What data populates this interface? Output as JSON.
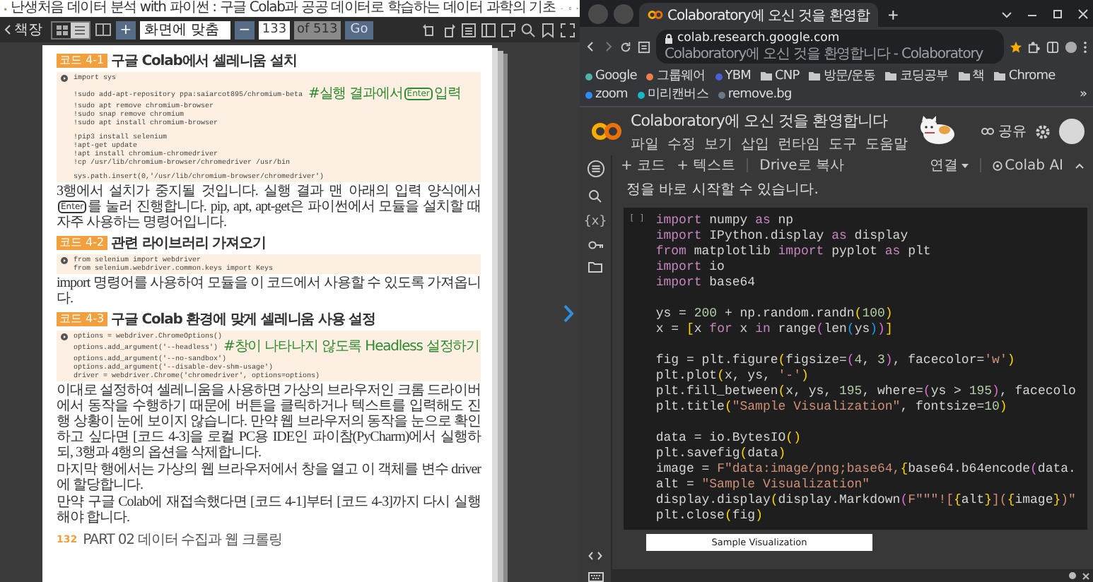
{
  "reader": {
    "title": "난생처음 데이터 분석 with 파이썬 : 구글 Colab과 공공 데이터로 학습하는 데이터 과학의 기초",
    "back_label": "책장",
    "view_modes": [
      {
        "kind": "grid",
        "selected": false
      },
      {
        "kind": "list",
        "selected": true
      }
    ],
    "zoom_in": "+",
    "zoom_mode": "화면에 맞춤",
    "zoom_out": "−",
    "page_input": "133",
    "page_total": "of 513",
    "go": "Go",
    "page": {
      "blocks": [
        {
          "kind": "code",
          "label": "코드 4-1",
          "title": "구글 Colab에서 셀레니움 설치",
          "lines": [
            {
              "kind": "code",
              "text": "import sys"
            },
            {
              "kind": "blank"
            },
            {
              "kind": "code",
              "text": "!sudo add-apt-repository ppa:saiarcot895/chromium-beta",
              "comment": [
                {
                  "kind": "text",
                  "text": "#실행 결과에서"
                },
                {
                  "kind": "key",
                  "text": "Enter"
                },
                {
                  "kind": "text",
                  "text": "입력"
                }
              ]
            },
            {
              "kind": "code",
              "text": "!sudo apt remove chromium-browser"
            },
            {
              "kind": "code",
              "text": "!sudo snap remove chromium"
            },
            {
              "kind": "code",
              "text": "!sudo apt install chromium-browser"
            },
            {
              "kind": "blank"
            },
            {
              "kind": "code",
              "text": "!pip3 install selenium"
            },
            {
              "kind": "code",
              "text": "!apt-get update"
            },
            {
              "kind": "code",
              "text": "!apt install chromium-chromedriver"
            },
            {
              "kind": "code",
              "text": "!cp /usr/lib/chromium-browser/chromedriver /usr/bin"
            },
            {
              "kind": "blank"
            },
            {
              "kind": "code",
              "text": "sys.path.insert(0,'/usr/lib/chromium-browser/chromedriver')"
            }
          ]
        },
        {
          "kind": "para",
          "segments": [
            {
              "kind": "text",
              "text": "3행에서 설치가 중지될 것입니다. 실행 결과 맨 아래의 입력 양식에서 "
            },
            {
              "kind": "key",
              "text": "Enter"
            },
            {
              "kind": "text",
              "text": "를 눌러 진행합니다. pip, apt, apt-get은 파이썬에서 모듈을 설치할 때 자주 사용하는 명령어입니다."
            }
          ]
        },
        {
          "kind": "code",
          "label": "코드 4-2",
          "title": "관련 라이브러리 가져오기",
          "lines": [
            {
              "kind": "code",
              "text": "from selenium import webdriver"
            },
            {
              "kind": "code",
              "text": "from selenium.webdriver.common.keys import Keys"
            }
          ]
        },
        {
          "kind": "para",
          "segments": [
            {
              "kind": "text",
              "text": "import 명령어를 사용하여 모듈을 이 코드에서 사용할 수 있도록 가져옵니다."
            }
          ]
        },
        {
          "kind": "code",
          "label": "코드 4-3",
          "title": "구글 Colab 환경에 맞게 셀레니움 사용 설정",
          "lines": [
            {
              "kind": "code",
              "text": "options = webdriver.ChromeOptions()"
            },
            {
              "kind": "code",
              "text": "options.add_argument('--headless')",
              "comment": [
                {
                  "kind": "text",
                  "text": "#창이 나타나지 않도록 Headless 설정하기"
                }
              ]
            },
            {
              "kind": "code",
              "text": "options.add_argument('--no-sandbox')"
            },
            {
              "kind": "code",
              "text": "options.add_argument('--disable-dev-shm-usage')"
            },
            {
              "kind": "code",
              "text": "driver = webdriver.Chrome('chromedriver', options=options)"
            }
          ]
        },
        {
          "kind": "para",
          "segments": [
            {
              "kind": "text",
              "text": "이대로 설정하여 셀레니움을 사용하면 가상의 브라우저인 크롬 드라이버에서 동작을 수행하기 때문에 버튼을 클릭하거나 텍스트를 입력해도 진행 상황이 눈에 보이지 않습니다. 만약 웹 브라우저의 동작을 눈으로 확인하고 싶다면 [코드 4-3]을 로컬 PC용 IDE인 파이참(PyCharm)에서 실행하되, 3행과 4행의 옵션을 삭제합니다."
            }
          ]
        },
        {
          "kind": "para",
          "segments": [
            {
              "kind": "text",
              "text": "마지막 행에서는 가상의 웹 브라우저에서 창을 열고 이 객체를 변수 driver에 할당합니다."
            }
          ]
        },
        {
          "kind": "para",
          "segments": [
            {
              "kind": "text",
              "text": "만약 구글 Colab에 재접속했다면 [코드 4-1]부터 [코드 4-3]까지 다시 실행해야 합니다."
            }
          ]
        }
      ],
      "footer": {
        "number": "132",
        "part": "PART 02 데이터 수집과 웹 크롤링"
      }
    }
  },
  "browser": {
    "tabs": [
      {
        "title": "Colaboratory에 오신 것을 환영합",
        "selected": true
      }
    ],
    "new_tab": "+",
    "url_host": "colab.research.google.com",
    "url_title": "Colaboratory에 오신 것을 환영합니다 - Colaboratory",
    "bookmarks": [
      {
        "kind": "site",
        "label": "Google",
        "color": "#4fb3a9"
      },
      {
        "kind": "site",
        "label": "그룹웨어",
        "color": "#f07c4a"
      },
      {
        "kind": "site",
        "label": "YBM",
        "color": "#4a5fd6"
      },
      {
        "kind": "folder",
        "label": "CNP"
      },
      {
        "kind": "folder",
        "label": "방문/운동"
      },
      {
        "kind": "folder",
        "label": "코딩공부"
      },
      {
        "kind": "folder",
        "label": "책"
      },
      {
        "kind": "folder",
        "label": "Chrome"
      },
      {
        "kind": "site",
        "label": "zoom",
        "color": "#2d8cff"
      },
      {
        "kind": "site",
        "label": "미리캔버스",
        "color": "#18b7c9"
      },
      {
        "kind": "site",
        "label": "remove.bg",
        "color": "#6b7785"
      }
    ],
    "more": "»"
  },
  "colab": {
    "title": "Colaboratory에 오신 것을 환영합니다",
    "menu": [
      "파일",
      "수정",
      "보기",
      "삽입",
      "런타임",
      "도구",
      "도움말"
    ],
    "share": "공유",
    "sidebar_variables": "{x}",
    "toolbar": {
      "add_code": "+ 코드",
      "add_text": "+ 텍스트",
      "copy_drive": "Drive로 복사",
      "connect": "연결",
      "ai": "Colab AI"
    },
    "text_cell": "정을 바로 시작할 수 있습니다.",
    "cell": {
      "bracket": "[ ]",
      "lines": [
        {
          "kind": "code",
          "tokens": [
            {
              "kind": "keyword",
              "text": "import"
            },
            {
              "kind": "plain",
              "text": " numpy "
            },
            {
              "kind": "keyword",
              "text": "as"
            },
            {
              "kind": "plain",
              "text": " np"
            }
          ]
        },
        {
          "kind": "code",
          "tokens": [
            {
              "kind": "keyword",
              "text": "import"
            },
            {
              "kind": "plain",
              "text": " IPython.display "
            },
            {
              "kind": "keyword",
              "text": "as"
            },
            {
              "kind": "plain",
              "text": " display"
            }
          ]
        },
        {
          "kind": "code",
          "tokens": [
            {
              "kind": "keyword",
              "text": "from"
            },
            {
              "kind": "plain",
              "text": " matplotlib "
            },
            {
              "kind": "keyword",
              "text": "import"
            },
            {
              "kind": "plain",
              "text": " pyplot "
            },
            {
              "kind": "keyword",
              "text": "as"
            },
            {
              "kind": "plain",
              "text": " plt"
            }
          ]
        },
        {
          "kind": "code",
          "tokens": [
            {
              "kind": "keyword",
              "text": "import"
            },
            {
              "kind": "plain",
              "text": " io"
            }
          ]
        },
        {
          "kind": "code",
          "tokens": [
            {
              "kind": "keyword",
              "text": "import"
            },
            {
              "kind": "plain",
              "text": " base64"
            }
          ]
        },
        {
          "kind": "blank"
        },
        {
          "kind": "code",
          "tokens": [
            {
              "kind": "plain",
              "text": "ys = "
            },
            {
              "kind": "number",
              "text": "200"
            },
            {
              "kind": "plain",
              "text": " + np.random.randn"
            },
            {
              "kind": "bracket",
              "text": "("
            },
            {
              "kind": "number",
              "text": "100"
            },
            {
              "kind": "bracket",
              "text": ")"
            }
          ]
        },
        {
          "kind": "code",
          "tokens": [
            {
              "kind": "plain",
              "text": "x = "
            },
            {
              "kind": "bracket",
              "text": "["
            },
            {
              "kind": "plain",
              "text": "x "
            },
            {
              "kind": "keyword",
              "text": "for"
            },
            {
              "kind": "plain",
              "text": " x "
            },
            {
              "kind": "keyword",
              "text": "in"
            },
            {
              "kind": "plain",
              "text": " range"
            },
            {
              "kind": "bracket2",
              "text": "("
            },
            {
              "kind": "plain",
              "text": "len"
            },
            {
              "kind": "bracket3",
              "text": "("
            },
            {
              "kind": "plain",
              "text": "ys"
            },
            {
              "kind": "bracket3",
              "text": ")"
            },
            {
              "kind": "bracket2",
              "text": ")"
            },
            {
              "kind": "bracket",
              "text": "]"
            }
          ]
        },
        {
          "kind": "blank"
        },
        {
          "kind": "code",
          "tokens": [
            {
              "kind": "plain",
              "text": "fig = plt.figure"
            },
            {
              "kind": "bracket",
              "text": "("
            },
            {
              "kind": "plain",
              "text": "figsize="
            },
            {
              "kind": "bracket2",
              "text": "("
            },
            {
              "kind": "number",
              "text": "4"
            },
            {
              "kind": "plain",
              "text": ", "
            },
            {
              "kind": "number",
              "text": "3"
            },
            {
              "kind": "bracket2",
              "text": ")"
            },
            {
              "kind": "plain",
              "text": ", facecolor="
            },
            {
              "kind": "string",
              "text": "'w'"
            },
            {
              "kind": "bracket",
              "text": ")"
            }
          ]
        },
        {
          "kind": "code",
          "tokens": [
            {
              "kind": "plain",
              "text": "plt.plot"
            },
            {
              "kind": "bracket",
              "text": "("
            },
            {
              "kind": "plain",
              "text": "x, ys, "
            },
            {
              "kind": "string",
              "text": "'-'"
            },
            {
              "kind": "bracket",
              "text": ")"
            }
          ]
        },
        {
          "kind": "code",
          "tokens": [
            {
              "kind": "plain",
              "text": "plt.fill_between"
            },
            {
              "kind": "bracket",
              "text": "("
            },
            {
              "kind": "plain",
              "text": "x, ys, "
            },
            {
              "kind": "number",
              "text": "195"
            },
            {
              "kind": "plain",
              "text": ", where="
            },
            {
              "kind": "bracket2",
              "text": "("
            },
            {
              "kind": "plain",
              "text": "ys > "
            },
            {
              "kind": "number",
              "text": "195"
            },
            {
              "kind": "bracket2",
              "text": ")"
            },
            {
              "kind": "plain",
              "text": ", facecolo"
            }
          ]
        },
        {
          "kind": "code",
          "tokens": [
            {
              "kind": "plain",
              "text": "plt.title"
            },
            {
              "kind": "bracket",
              "text": "("
            },
            {
              "kind": "string",
              "text": "\"Sample Visualization\""
            },
            {
              "kind": "plain",
              "text": ", fontsize="
            },
            {
              "kind": "number",
              "text": "10"
            },
            {
              "kind": "bracket",
              "text": ")"
            }
          ]
        },
        {
          "kind": "blank"
        },
        {
          "kind": "code",
          "tokens": [
            {
              "kind": "plain",
              "text": "data = io.BytesIO"
            },
            {
              "kind": "bracket",
              "text": "()"
            }
          ]
        },
        {
          "kind": "code",
          "tokens": [
            {
              "kind": "plain",
              "text": "plt.savefig"
            },
            {
              "kind": "bracket",
              "text": "("
            },
            {
              "kind": "plain",
              "text": "data"
            },
            {
              "kind": "bracket",
              "text": ")"
            }
          ]
        },
        {
          "kind": "code",
          "tokens": [
            {
              "kind": "plain",
              "text": "image = "
            },
            {
              "kind": "string",
              "text": "F\"data:image/png;base64,"
            },
            {
              "kind": "bracket",
              "text": "{"
            },
            {
              "kind": "plain",
              "text": "base64.b64encode"
            },
            {
              "kind": "bracket2",
              "text": "("
            },
            {
              "kind": "plain",
              "text": "data."
            }
          ]
        },
        {
          "kind": "code",
          "tokens": [
            {
              "kind": "plain",
              "text": "alt = "
            },
            {
              "kind": "string",
              "text": "\"Sample Visualization\""
            }
          ]
        },
        {
          "kind": "code",
          "tokens": [
            {
              "kind": "plain",
              "text": "display.display"
            },
            {
              "kind": "bracket",
              "text": "("
            },
            {
              "kind": "plain",
              "text": "display.Markdown"
            },
            {
              "kind": "bracket2",
              "text": "("
            },
            {
              "kind": "string",
              "text": "F\"\"\"!["
            },
            {
              "kind": "bracket",
              "text": "{"
            },
            {
              "kind": "plain",
              "text": "alt"
            },
            {
              "kind": "bracket",
              "text": "}"
            },
            {
              "kind": "string",
              "text": "]("
            },
            {
              "kind": "bracket",
              "text": "{"
            },
            {
              "kind": "plain",
              "text": "image"
            },
            {
              "kind": "bracket",
              "text": "}"
            },
            {
              "kind": "string",
              "text": ")\""
            }
          ]
        },
        {
          "kind": "code",
          "tokens": [
            {
              "kind": "plain",
              "text": "plt.close"
            },
            {
              "kind": "bracket",
              "text": "("
            },
            {
              "kind": "plain",
              "text": "fig"
            },
            {
              "kind": "bracket",
              "text": ")"
            }
          ]
        }
      ]
    },
    "output_title": "Sample Visualization"
  }
}
